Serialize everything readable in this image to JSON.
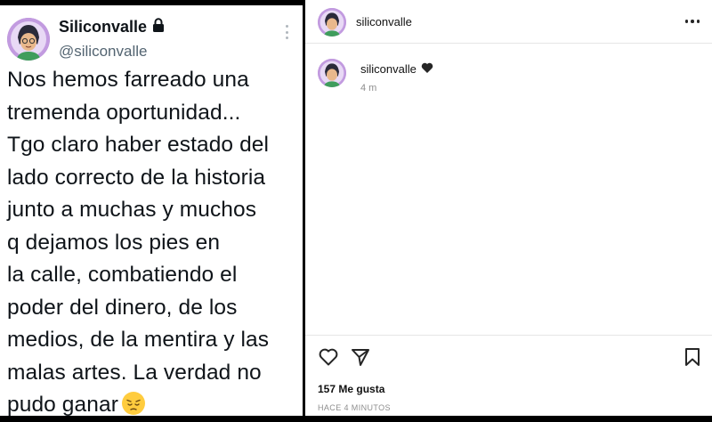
{
  "tweet": {
    "name": "Siliconvalle",
    "handle": "@siliconvalle",
    "lines": [
      "Nos hemos farreado una",
      "tremenda oportunidad...",
      "Tgo claro haber estado del",
      "lado correcto de la historia",
      "junto a muchas y muchos",
      "q dejamos los pies en",
      "la calle, combatiendo el",
      "poder del dinero, de los",
      "medios, de la mentira y las",
      "malas artes. La verdad no",
      "pudo ganar"
    ]
  },
  "instagram": {
    "header_username": "siliconvalle",
    "caption_username": "siliconvalle",
    "caption_time": "4 m",
    "likes": "157 Me gusta",
    "posted_ago": "HACE 4 MINUTOS"
  },
  "icons": {
    "lock": "lock-icon",
    "more_vertical": "more-vertical-icon",
    "more_horizontal": "more-horizontal-icon",
    "heart_black": "black-heart-icon",
    "like": "heart-outline-icon",
    "share": "paper-plane-icon",
    "save": "bookmark-icon",
    "emoji": "pensive-face-emoji"
  },
  "colors": {
    "tweet_text": "#0f1419",
    "handle": "#536471",
    "muted": "#8e8e8e",
    "avatar_bg": "#b58ad0"
  }
}
